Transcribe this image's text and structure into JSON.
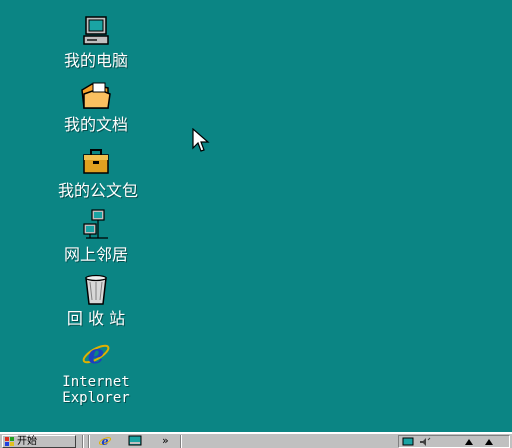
{
  "desktop": {
    "background_color": "#0b8584",
    "icons": [
      {
        "id": "my-computer",
        "label": "我的电脑",
        "icon": "computer-icon"
      },
      {
        "id": "my-documents",
        "label": "我的文档",
        "icon": "folder-icon"
      },
      {
        "id": "my-briefcase",
        "label": "我的公文包",
        "icon": "briefcase-icon"
      },
      {
        "id": "network-neighborhood",
        "label": "网上邻居",
        "icon": "network-icon"
      },
      {
        "id": "recycle-bin",
        "label": "回 收 站",
        "icon": "recycle-bin-icon"
      },
      {
        "id": "internet-explorer",
        "label": "Internet Explorer",
        "icon": "ie-icon"
      }
    ]
  },
  "taskbar": {
    "start_label": "开始",
    "quick_launch": [
      "ie-icon",
      "desktop-icon"
    ],
    "chevron": "»",
    "tray_icons": [
      "display-icon",
      "volume-icon",
      "arrow-icon",
      "arrow-icon"
    ]
  },
  "colors": {
    "desktop": "#0b8584",
    "taskbar": "#c0c0c0",
    "folder": "#f5a02a",
    "briefcase": "#e0a020",
    "ie": "#1e3fbf"
  }
}
